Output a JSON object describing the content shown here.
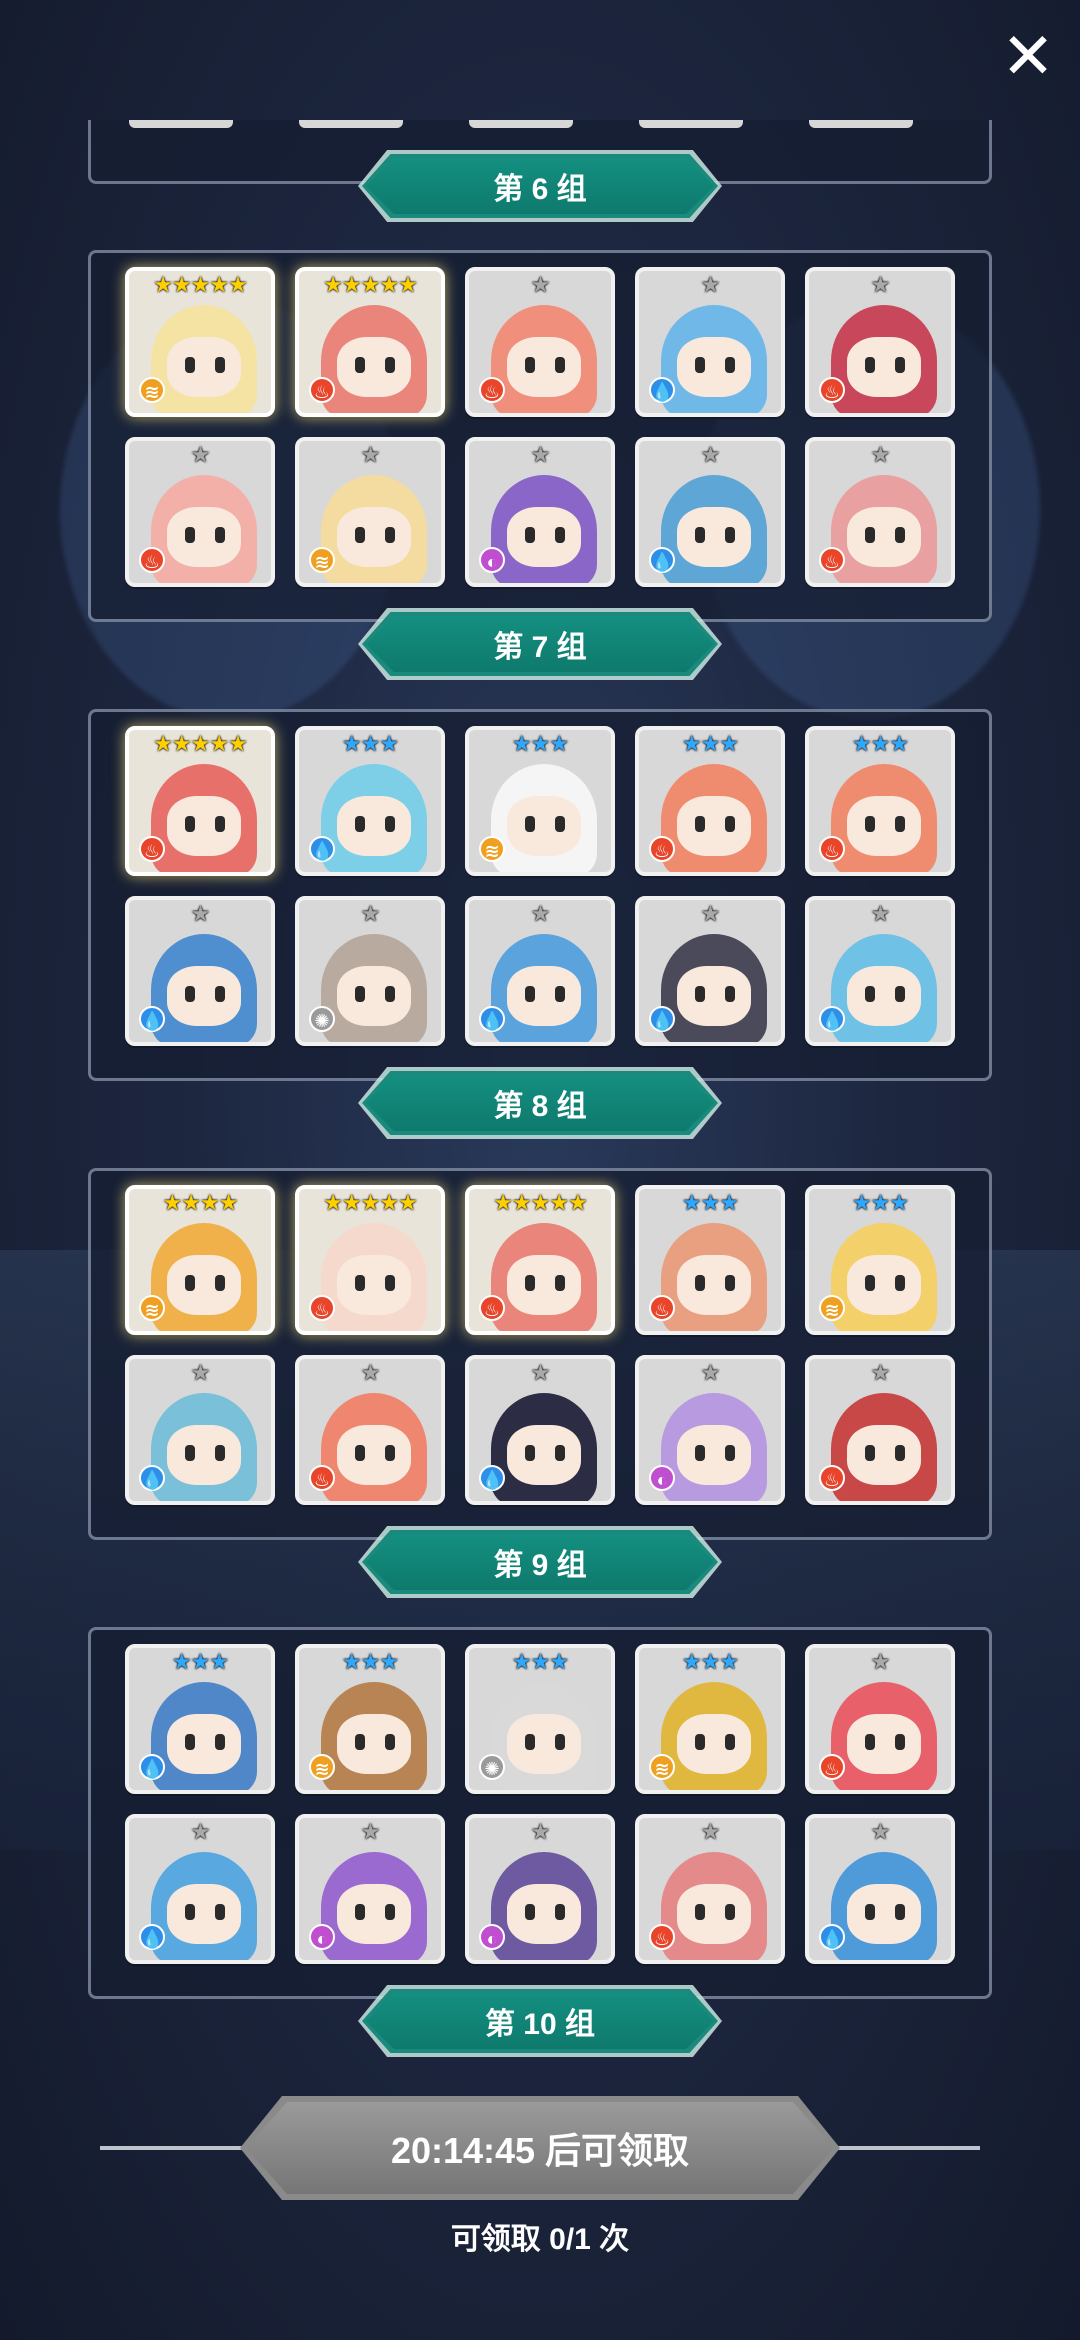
{
  "close_button": {
    "symbol": "✕"
  },
  "groups": [
    {
      "label": "第 6 组",
      "partial": true
    },
    {
      "label": "第 7 组",
      "heroes": [
        {
          "stars": "★★★★★",
          "tier": "gold",
          "element": "wind",
          "hair": "#f5e3a4"
        },
        {
          "stars": "★★★★★",
          "tier": "gold",
          "element": "fire",
          "hair": "#e9857a"
        },
        {
          "stars": "★",
          "tier": "silver",
          "element": "fire",
          "hair": "#f08f7c"
        },
        {
          "stars": "★",
          "tier": "silver",
          "element": "water",
          "hair": "#6fb8e8"
        },
        {
          "stars": "★",
          "tier": "silver",
          "element": "fire",
          "hair": "#c8475a"
        },
        {
          "stars": "★",
          "tier": "silver",
          "element": "fire",
          "hair": "#f2b0a8"
        },
        {
          "stars": "★",
          "tier": "silver",
          "element": "wind",
          "hair": "#f4dca0"
        },
        {
          "stars": "★",
          "tier": "silver",
          "element": "shadow",
          "hair": "#8a66c8"
        },
        {
          "stars": "★",
          "tier": "silver",
          "element": "water",
          "hair": "#5da6d6"
        },
        {
          "stars": "★",
          "tier": "silver",
          "element": "fire",
          "hair": "#e9a0a0"
        }
      ]
    },
    {
      "label": "第 8 组",
      "heroes": [
        {
          "stars": "★★★★★",
          "tier": "gold",
          "element": "fire",
          "hair": "#e8706a"
        },
        {
          "stars": "★★★",
          "tier": "blue",
          "element": "water",
          "hair": "#7dcfe8"
        },
        {
          "stars": "★★★",
          "tier": "blue",
          "element": "wind",
          "hair": "#f5f5f5"
        },
        {
          "stars": "★★★",
          "tier": "blue",
          "element": "fire",
          "hair": "#ef8c6f"
        },
        {
          "stars": "★★★",
          "tier": "blue",
          "element": "fire",
          "hair": "#ef8c6f"
        },
        {
          "stars": "★",
          "tier": "silver",
          "element": "water",
          "hair": "#4f8fcf"
        },
        {
          "stars": "★",
          "tier": "silver",
          "element": "light",
          "hair": "#b9aaa0"
        },
        {
          "stars": "★",
          "tier": "silver",
          "element": "water",
          "hair": "#5aa3dd"
        },
        {
          "stars": "★",
          "tier": "silver",
          "element": "water",
          "hair": "#4a4a5a"
        },
        {
          "stars": "★",
          "tier": "silver",
          "element": "water",
          "hair": "#6fc2e6"
        }
      ]
    },
    {
      "label": "第 9 组",
      "heroes": [
        {
          "stars": "★★★★",
          "tier": "gold",
          "element": "wind",
          "hair": "#f1b14a"
        },
        {
          "stars": "★★★★★",
          "tier": "gold",
          "element": "fire",
          "hair": "#f6d9cd"
        },
        {
          "stars": "★★★★★",
          "tier": "gold",
          "element": "fire",
          "hair": "#e9857a"
        },
        {
          "stars": "★★★",
          "tier": "blue",
          "element": "fire",
          "hair": "#e8a080"
        },
        {
          "stars": "★★★",
          "tier": "blue",
          "element": "wind",
          "hair": "#f3d06a"
        },
        {
          "stars": "★",
          "tier": "silver",
          "element": "water",
          "hair": "#7ac0d8"
        },
        {
          "stars": "★",
          "tier": "silver",
          "element": "fire",
          "hair": "#ef8770"
        },
        {
          "stars": "★",
          "tier": "silver",
          "element": "water",
          "hair": "#2c2c44"
        },
        {
          "stars": "★",
          "tier": "silver",
          "element": "shadow",
          "hair": "#b79ae0"
        },
        {
          "stars": "★",
          "tier": "silver",
          "element": "fire",
          "hair": "#c84848"
        }
      ]
    },
    {
      "label": "第 10 组",
      "heroes": [
        {
          "stars": "★★★",
          "tier": "blue",
          "element": "water",
          "hair": "#4f87c9"
        },
        {
          "stars": "★★★",
          "tier": "blue",
          "element": "wind",
          "hair": "#b88454"
        },
        {
          "stars": "★★★",
          "tier": "blue",
          "element": "light",
          "hair": "#d9d9d9"
        },
        {
          "stars": "★★★",
          "tier": "blue",
          "element": "wind",
          "hair": "#e0b840"
        },
        {
          "stars": "★",
          "tier": "silver",
          "element": "fire",
          "hair": "#e8606a"
        },
        {
          "stars": "★",
          "tier": "silver",
          "element": "water",
          "hair": "#5aa8e0"
        },
        {
          "stars": "★",
          "tier": "silver",
          "element": "shadow",
          "hair": "#9a6ad0"
        },
        {
          "stars": "★",
          "tier": "silver",
          "element": "shadow",
          "hair": "#6e5aa0"
        },
        {
          "stars": "★",
          "tier": "silver",
          "element": "fire",
          "hair": "#e58a8a"
        },
        {
          "stars": "★",
          "tier": "silver",
          "element": "water",
          "hair": "#4f9ad8"
        }
      ]
    }
  ],
  "element_icons": {
    "fire": "♨",
    "water": "💧",
    "wind": "≋",
    "shadow": "◐",
    "light": "✺"
  },
  "element_colors": {
    "fire": "#e8452a",
    "water": "#2e8fe8",
    "wind": "#f0a020",
    "shadow": "#c04fd0",
    "light": "#9a9a9a"
  },
  "claim": {
    "button_label": "20:14:45 后可领取",
    "count_text": "可领取 0/1 次"
  }
}
